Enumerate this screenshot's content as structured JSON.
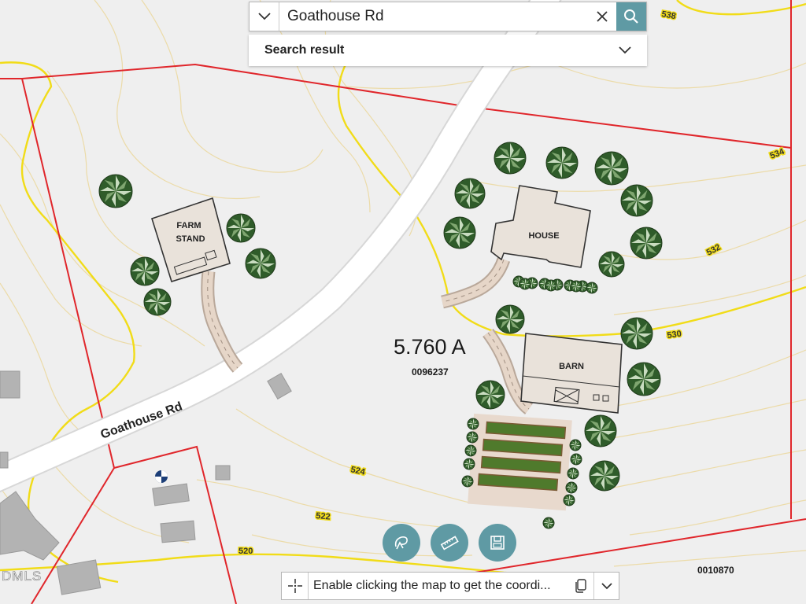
{
  "search": {
    "value": "Goathouse Rd",
    "result_label": "Search result"
  },
  "map": {
    "road_label": "Goathouse Rd",
    "acreage": "5.760 A",
    "parcel_id": "0096237",
    "adjacent_parcel_id": "0010870",
    "buildings": {
      "farm_stand_line1": "FARM",
      "farm_stand_line2": "STAND",
      "house": "HOUSE",
      "barn": "BARN"
    },
    "contours": [
      "538",
      "534",
      "532",
      "530",
      "524",
      "522",
      "520"
    ],
    "watermark": "DMLS"
  },
  "coords": {
    "text": "Enable clicking the map to get the coordi..."
  },
  "colors": {
    "accent": "#5f9aa4",
    "parcel_line": "#e0262b",
    "contour_major": "#f1dc18",
    "contour_minor": "#ecdba8",
    "background": "#efefef"
  },
  "tools": {
    "icons": [
      "measure-area-icon",
      "ruler-icon",
      "save-icon"
    ]
  }
}
